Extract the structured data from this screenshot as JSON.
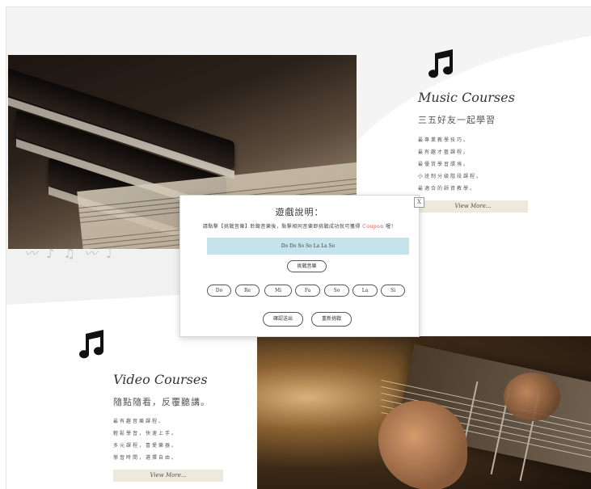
{
  "music": {
    "title": "Music Courses",
    "subtitle": "三五好友一起學習",
    "features": [
      "最專業教學技巧。",
      "最有趣才藝課程。",
      "最優質學習環境。",
      "小班制分級階段課程。",
      "最適合的師資教學。"
    ],
    "more_label": "View More..."
  },
  "video": {
    "title": "Video Courses",
    "subtitle": "隨點隨看，反覆聽講。",
    "features": [
      "最有趣音樂課程。",
      "輕鬆學習，快速上手。",
      "多元課程，喜愛樂器。",
      "學習時間，選擇自由。"
    ],
    "more_label": "View More..."
  },
  "modal": {
    "close_label": "X",
    "title": "遊戲說明：",
    "desc_prefix": "請點擊【挑戰音樂】聆聽音樂後，點擊相同音樂即挑戰成功就可獲得",
    "coupon_text": "Coupon",
    "desc_suffix": "喔！",
    "answer": "Do Do So So La La So",
    "challenge_label": "挑戰音樂",
    "notes": [
      "Do",
      "Re",
      "Mi",
      "Fa",
      "So",
      "La",
      "Si"
    ],
    "confirm_label": "確認送出",
    "retry_label": "重新挑戰"
  }
}
